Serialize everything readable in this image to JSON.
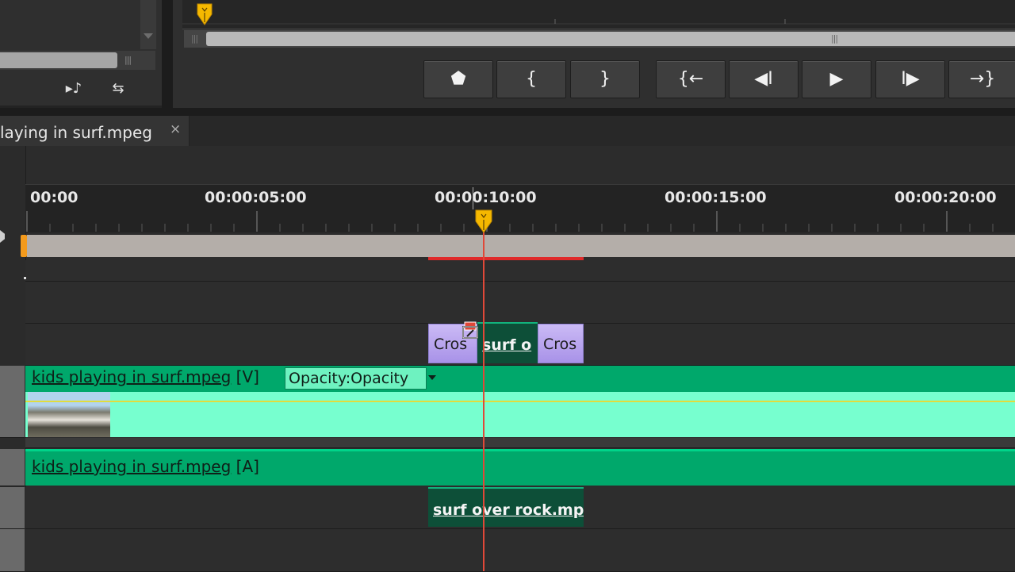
{
  "source_monitor": {
    "controls": [
      {
        "name": "insert-audio",
        "glyph": "▸♪"
      },
      {
        "name": "export-frame",
        "glyph": "⇆"
      }
    ]
  },
  "program_monitor": {
    "buttons": [
      {
        "name": "add-marker",
        "glyph": "⬟"
      },
      {
        "name": "mark-in",
        "glyph": "{"
      },
      {
        "name": "mark-out",
        "glyph": "}"
      },
      {
        "name": "go-to-in",
        "glyph": "{←"
      },
      {
        "name": "step-back",
        "glyph": "◀I"
      },
      {
        "name": "play",
        "glyph": "▶"
      },
      {
        "name": "step-forward",
        "glyph": "I▶"
      },
      {
        "name": "go-to-out",
        "glyph": "→}"
      }
    ]
  },
  "sequence": {
    "tab_title": "laying in surf.mpeg",
    "close_glyph": "×"
  },
  "ruler": {
    "timecodes": [
      "00:00",
      "00:00:05:00",
      "00:00:10:00",
      "00:00:15:00",
      "00:00:20:00"
    ]
  },
  "clips": {
    "transition_left": "Cros",
    "transition_right": "Cros",
    "overlay_clip": "surf o",
    "video_clip_name": "kids playing in surf.mpeg",
    "video_clip_suffix": "[V]",
    "opacity_menu": "Opacity:Opacity",
    "audio_clip_name": "kids playing in surf.mpeg",
    "audio_clip_suffix": "[A]",
    "audio_overlay_clip": "surf over rock.mp"
  },
  "colors": {
    "clip_green": "#00a86b",
    "clip_light": "#77ffcf",
    "transition": "#b9a6f0",
    "playhead": "#e04838",
    "work_area_marker": "#f39a1c"
  }
}
